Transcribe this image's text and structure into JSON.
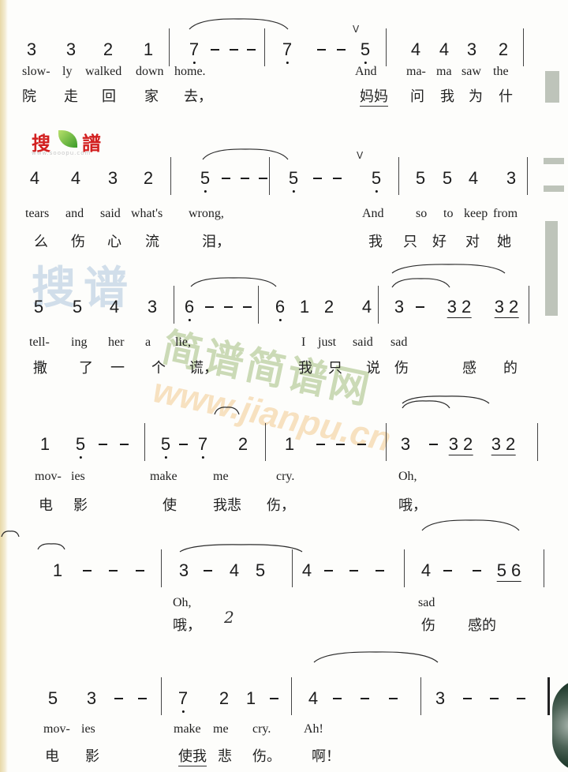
{
  "watermarks": {
    "logo_left": "搜",
    "logo_right": "譜",
    "logo_url": "www.sooopu.com",
    "main_cn_1": "搜谱",
    "main_cn_2": "简谱简谱网",
    "main_url": "www.jianpu.cn"
  },
  "page_number": "2",
  "lines": [
    {
      "notes": [
        "3",
        "3",
        "2",
        "1",
        "7̣",
        "-",
        "-",
        "-",
        "7̣",
        "-",
        "-",
        "5̣",
        "4",
        "4",
        "3",
        "2"
      ],
      "lyrics_en": [
        "slow-",
        "ly",
        "walked",
        "down",
        "home.",
        "And",
        "ma-",
        "ma",
        "saw",
        "the"
      ],
      "lyrics_cn": [
        "院",
        "走",
        "回",
        "家",
        "去，",
        "妈妈",
        "问",
        "我",
        "为",
        "什"
      ]
    },
    {
      "notes": [
        "4",
        "4",
        "3",
        "2",
        "5̣",
        "-",
        "-",
        "-",
        "5̣",
        "-",
        "-",
        "5̣",
        "5",
        "5",
        "4",
        "3"
      ],
      "lyrics_en": [
        "tears",
        "and",
        "said",
        "what's",
        "wrong,",
        "And",
        "so",
        "to",
        "keep",
        "from"
      ],
      "lyrics_cn": [
        "么",
        "伤",
        "心",
        "流",
        "泪，",
        "我",
        "只",
        "好",
        "对",
        "她"
      ]
    },
    {
      "notes": [
        "5",
        "5",
        "4",
        "3",
        "6̣",
        "-",
        "-",
        "-",
        "6̣",
        "1",
        "2",
        "4",
        "3",
        "-",
        "32",
        "32"
      ],
      "lyrics_en": [
        "tell-",
        "ing",
        "her",
        "a",
        "lie,",
        "I",
        "just",
        "said",
        "sad"
      ],
      "lyrics_cn": [
        "撒",
        "了",
        "一",
        "个",
        "谎，",
        "我",
        "只",
        "说",
        "伤",
        "感",
        "的"
      ]
    },
    {
      "notes": [
        "1",
        "5̣",
        "-",
        "-",
        "5̣",
        "-",
        "7̣",
        "2",
        "1",
        "-",
        "-",
        "-",
        "3",
        "-",
        "32",
        "32"
      ],
      "lyrics_en": [
        "mov-",
        "ies",
        "make",
        "me",
        "cry.",
        "Oh,"
      ],
      "lyrics_cn": [
        "电",
        "影",
        "使",
        "我悲",
        "伤，",
        "哦，"
      ]
    },
    {
      "notes": [
        "1",
        "-",
        "-",
        "-",
        "3",
        "-",
        "4",
        "5",
        "4",
        "-",
        "-",
        "-",
        "4",
        "-",
        "-",
        "56"
      ],
      "lyrics_en": [
        "Oh,",
        "sad"
      ],
      "lyrics_cn": [
        "哦，",
        "伤",
        "感的"
      ]
    },
    {
      "notes": [
        "5",
        "3",
        "-",
        "-",
        "7̣",
        "2",
        "1",
        "-",
        "4",
        "-",
        "-",
        "-",
        "3",
        "-",
        "-",
        "-"
      ],
      "lyrics_en": [
        "mov-",
        "ies",
        "make",
        "me",
        "cry.",
        "Ah!"
      ],
      "lyrics_cn": [
        "电",
        "影",
        "使我",
        "悲",
        "伤。",
        "啊！"
      ]
    }
  ]
}
